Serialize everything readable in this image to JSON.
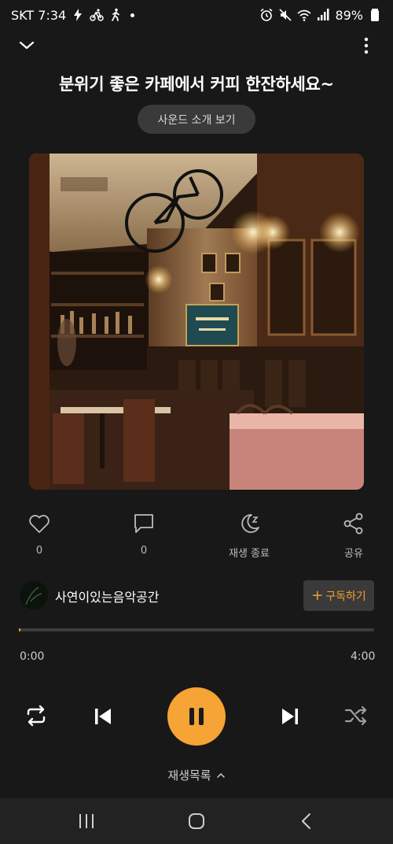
{
  "status_bar": {
    "carrier_time": "SKT 7:34",
    "battery": "89%",
    "icons_left": [
      "bolt-icon",
      "bike-icon",
      "walk-icon",
      "dot-icon"
    ],
    "icons_right": [
      "alarm-icon",
      "mute-icon",
      "wifi-icon",
      "signal-icon",
      "battery-icon"
    ]
  },
  "header": {
    "collapse_icon": "chevron-down-icon",
    "more_icon": "more-vertical-icon"
  },
  "track": {
    "title": "분위기 좋은 카페에서 커피 한잔하세요~",
    "intro_button": "사운드 소개 보기"
  },
  "actions": {
    "like": {
      "icon": "heart-icon",
      "label": "0"
    },
    "comment": {
      "icon": "comment-icon",
      "label": "0"
    },
    "sleep_timer": {
      "icon": "sleep-icon",
      "label": "재생 종료"
    },
    "share": {
      "icon": "share-icon",
      "label": "공유"
    }
  },
  "channel": {
    "name": "사연이있는음악공간",
    "subscribe_label": "구독하기",
    "subscribe_plus": "+"
  },
  "progress": {
    "elapsed": "0:00",
    "duration": "4:00",
    "fraction": 0.004
  },
  "controls": {
    "repeat_icon": "repeat-icon",
    "prev_icon": "skip-previous-icon",
    "play_pause_icon": "pause-icon",
    "next_icon": "skip-next-icon",
    "shuffle_icon": "shuffle-icon",
    "playlist_label": "재생목록"
  },
  "colors": {
    "accent": "#f6a435",
    "background": "#181818",
    "button_bg": "#3a3a3a",
    "nav_bg": "#222222"
  },
  "nav_bar": {
    "icons": [
      "recent-apps-icon",
      "home-icon",
      "back-icon"
    ]
  }
}
